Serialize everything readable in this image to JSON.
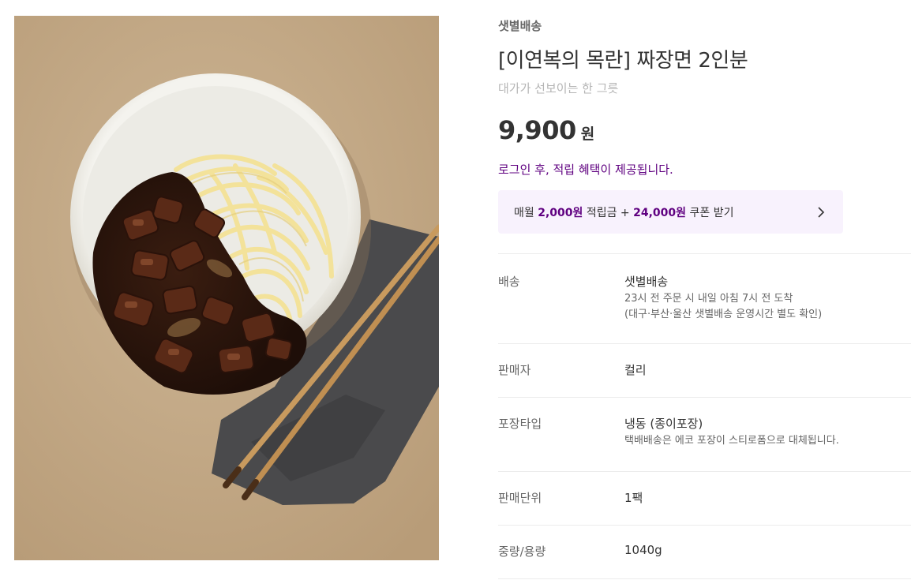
{
  "product": {
    "delivery_tag": "샛별배송",
    "title": "[이연복의 목란] 짜장면 2인분",
    "subtitle": "대가가 선보이는 한 그릇",
    "price": "9,900",
    "price_unit": "원",
    "login_note": "로그인 후, 적립 혜택이 제공됩니다.",
    "image_alt": "짜장면 한 그릇과 젓가락"
  },
  "coupon": {
    "prefix": "매월 ",
    "points": "2,000원",
    "mid": " 적립금 + ",
    "coupon_amount": "24,000원",
    "suffix": " 쿠폰 받기",
    "arrow_icon": "chevron-right-icon"
  },
  "details": {
    "delivery": {
      "label": "배송",
      "value": "샛별배송",
      "note1": "23시 전 주문 시 내일 아침 7시 전 도착",
      "note2": "(대구·부산·울산 샛별배송 운영시간 별도 확인)"
    },
    "seller": {
      "label": "판매자",
      "value": "컬리"
    },
    "packaging": {
      "label": "포장타입",
      "value": "냉동 (종이포장)",
      "note": "택배배송은 에코 포장이 스티로폼으로 대체됩니다."
    },
    "sales_unit": {
      "label": "판매단위",
      "value": "1팩"
    },
    "weight": {
      "label": "중량/용량",
      "value": "1040g"
    }
  },
  "colors": {
    "accent": "#5f0080",
    "banner_bg": "#f8f2fd",
    "divider": "#ececec"
  }
}
